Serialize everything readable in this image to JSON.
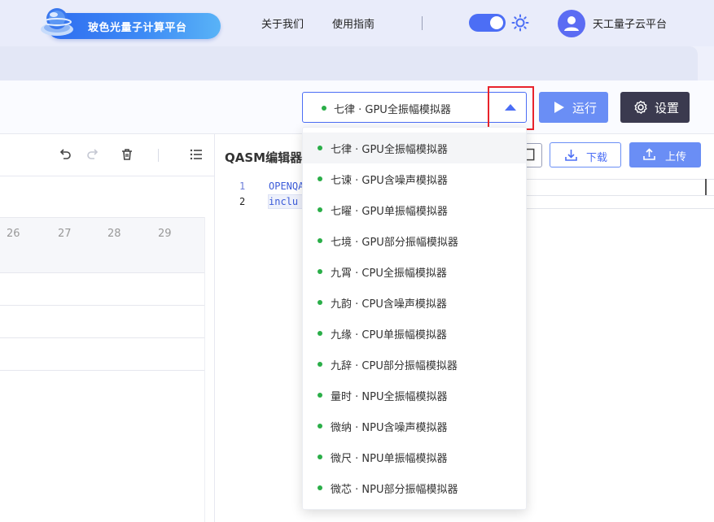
{
  "header": {
    "logo_text": "玻色光量子计算平台",
    "nav": [
      {
        "label": "关于我们"
      },
      {
        "label": "使用指南"
      }
    ],
    "divider": "|",
    "user_name": "天工量子云平台"
  },
  "toolbar": {
    "simulator_select": {
      "value": "七律 · GPU全振幅模拟器",
      "expanded": true
    },
    "run_label": "运行",
    "settings_label": "设置"
  },
  "left_pane": {
    "column_numbers": [
      "26",
      "27",
      "28",
      "29"
    ]
  },
  "editor": {
    "title": "QASM编辑器",
    "download_label": "下载",
    "upload_label": "上传",
    "lines": [
      {
        "no": "1",
        "text": "OPENQA"
      },
      {
        "no": "2",
        "text": "inclu"
      }
    ]
  },
  "dropdown": {
    "options": [
      {
        "label": "七律 · GPU全振幅模拟器",
        "selected": true
      },
      {
        "label": "七谏 · GPU含噪声模拟器"
      },
      {
        "label": "七曜 · GPU单振幅模拟器"
      },
      {
        "label": "七境 · GPU部分振幅模拟器"
      },
      {
        "label": "九霄 · CPU全振幅模拟器"
      },
      {
        "label": "九韵 · CPU含噪声模拟器"
      },
      {
        "label": "九缘 · CPU单振幅模拟器"
      },
      {
        "label": "九辞 · CPU部分振幅模拟器"
      },
      {
        "label": "量时 · NPU全振幅模拟器"
      },
      {
        "label": "微纳 · NPU含噪声模拟器"
      },
      {
        "label": "微尺 · NPU单振幅模拟器"
      },
      {
        "label": "微芯 · NPU部分振幅模拟器"
      }
    ]
  },
  "colors": {
    "accent": "#4c6ef5",
    "button_blue": "#6a8ef5",
    "settings_dark": "#3b3a4f",
    "status_green": "#2aae48",
    "highlight_red": "#e8232b"
  },
  "icons": {
    "logo": "orb-logo-icon",
    "theme": "sun-icon",
    "user": "user-avatar-icon",
    "undo": "undo-icon",
    "redo": "redo-icon",
    "delete": "trash-icon",
    "menu": "list-icon",
    "copy": "copy-icon",
    "download": "download-icon",
    "upload": "upload-icon",
    "run": "play-icon",
    "settings": "gear-icon"
  }
}
